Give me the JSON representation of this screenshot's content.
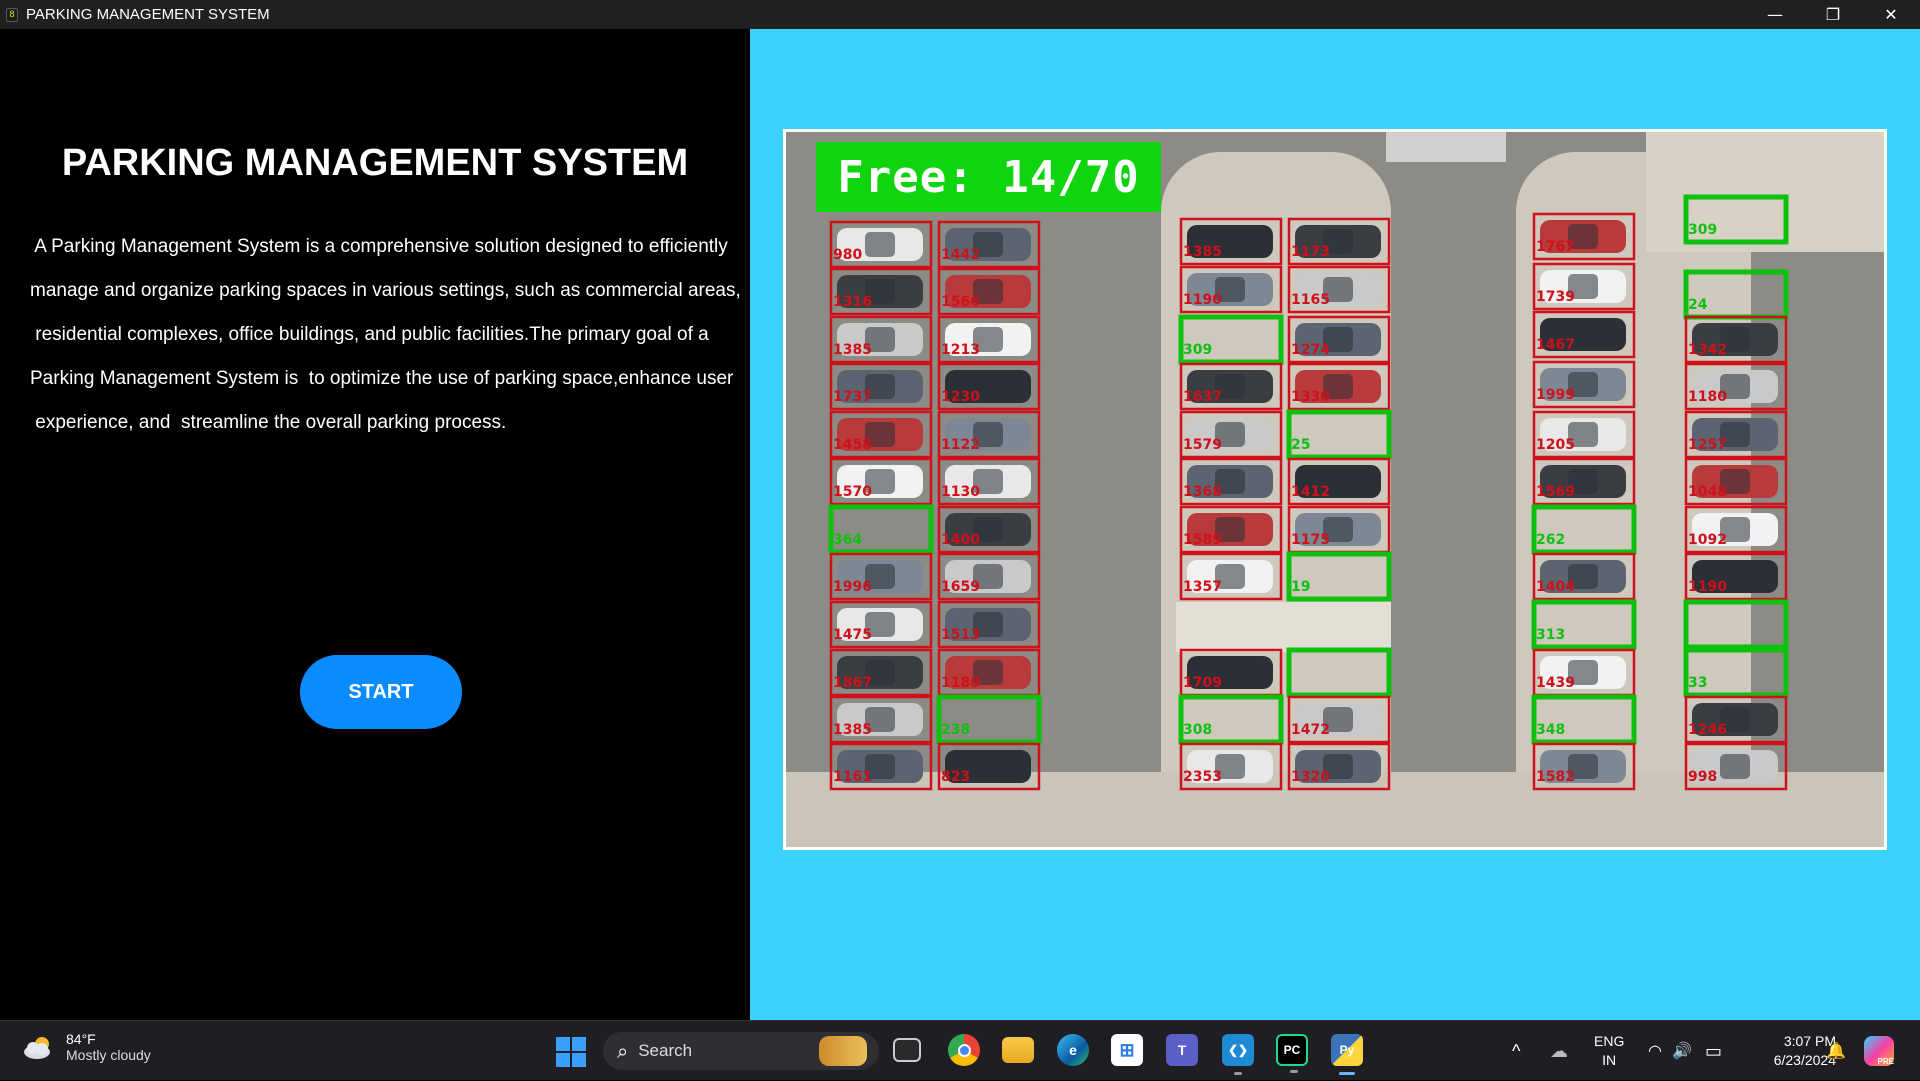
{
  "window": {
    "title": "PARKING MANAGEMENT SYSTEM",
    "app_icon_glyph": "8",
    "minimize_glyph": "—",
    "restore_glyph": "❐",
    "close_glyph": "✕"
  },
  "left_panel": {
    "heading": "PARKING MANAGEMENT SYSTEM",
    "description_lines": [
      " A Parking Management System is a comprehensive solution designed to efficiently",
      "manage and organize parking spaces in various settings, such as commercial areas,",
      " residential complexes, office buildings, and public facilities.The primary goal of a",
      "Parking Management System is  to optimize the use of parking space,enhance user",
      " experience, and  streamline the overall parking process."
    ],
    "start_button": "START"
  },
  "video": {
    "free_label": "Free: 14/70",
    "free_count": 14,
    "total_count": 70,
    "colors": {
      "free": "#10c010",
      "occupied": "#d0101a",
      "label_bg": "#0fd40f"
    },
    "columns": [
      [
        {
          "id": "980",
          "status": "occupied"
        },
        {
          "id": "1316",
          "status": "occupied"
        },
        {
          "id": "1385",
          "status": "occupied"
        },
        {
          "id": "1737",
          "status": "occupied"
        },
        {
          "id": "1458",
          "status": "occupied"
        },
        {
          "id": "1570",
          "status": "occupied"
        },
        {
          "id": "364",
          "status": "free"
        },
        {
          "id": "1996",
          "status": "occupied"
        },
        {
          "id": "1475",
          "status": "occupied"
        },
        {
          "id": "1867",
          "status": "occupied"
        },
        {
          "id": "1385",
          "status": "occupied"
        },
        {
          "id": "1161",
          "status": "occupied"
        }
      ],
      [
        {
          "id": "1442",
          "status": "occupied"
        },
        {
          "id": "1566",
          "status": "occupied"
        },
        {
          "id": "1213",
          "status": "occupied"
        },
        {
          "id": "1230",
          "status": "occupied"
        },
        {
          "id": "1122",
          "status": "occupied"
        },
        {
          "id": "1130",
          "status": "occupied"
        },
        {
          "id": "1400",
          "status": "occupied"
        },
        {
          "id": "1659",
          "status": "occupied"
        },
        {
          "id": "1513",
          "status": "occupied"
        },
        {
          "id": "1180",
          "status": "occupied"
        },
        {
          "id": "238",
          "status": "free"
        },
        {
          "id": "823",
          "status": "occupied"
        }
      ],
      [
        {
          "id": "1385",
          "status": "occupied"
        },
        {
          "id": "1190",
          "status": "occupied"
        },
        {
          "id": "309",
          "status": "free"
        },
        {
          "id": "1637",
          "status": "occupied"
        },
        {
          "id": "1579",
          "status": "occupied"
        },
        {
          "id": "1368",
          "status": "occupied"
        },
        {
          "id": "1589",
          "status": "occupied"
        },
        {
          "id": "1357",
          "status": "occupied"
        },
        {
          "id": "1709",
          "status": "occupied"
        },
        {
          "id": "308",
          "status": "free"
        },
        {
          "id": "2353",
          "status": "occupied"
        }
      ],
      [
        {
          "id": "1173",
          "status": "occupied"
        },
        {
          "id": "1165",
          "status": "occupied"
        },
        {
          "id": "1274",
          "status": "occupied"
        },
        {
          "id": "1330",
          "status": "occupied"
        },
        {
          "id": "25",
          "status": "free"
        },
        {
          "id": "1412",
          "status": "occupied"
        },
        {
          "id": "1175",
          "status": "occupied"
        },
        {
          "id": "19",
          "status": "free"
        },
        {
          "id": "",
          "status": "free"
        },
        {
          "id": "1472",
          "status": "occupied"
        },
        {
          "id": "1320",
          "status": "occupied"
        }
      ],
      [
        {
          "id": "1767",
          "status": "occupied"
        },
        {
          "id": "1739",
          "status": "occupied"
        },
        {
          "id": "1467",
          "status": "occupied"
        },
        {
          "id": "1999",
          "status": "occupied"
        },
        {
          "id": "1205",
          "status": "occupied"
        },
        {
          "id": "1569",
          "status": "occupied"
        },
        {
          "id": "262",
          "status": "free"
        },
        {
          "id": "1404",
          "status": "occupied"
        },
        {
          "id": "313",
          "status": "free"
        },
        {
          "id": "1439",
          "status": "occupied"
        },
        {
          "id": "348",
          "status": "free"
        },
        {
          "id": "1582",
          "status": "occupied"
        }
      ],
      [
        {
          "id": "309",
          "status": "free"
        },
        {
          "id": "24",
          "status": "free"
        },
        {
          "id": "1342",
          "status": "occupied"
        },
        {
          "id": "1180",
          "status": "occupied"
        },
        {
          "id": "1257",
          "status": "occupied"
        },
        {
          "id": "1048",
          "status": "occupied"
        },
        {
          "id": "1092",
          "status": "occupied"
        },
        {
          "id": "1190",
          "status": "occupied"
        },
        {
          "id": "",
          "status": "free"
        },
        {
          "id": "33",
          "status": "free"
        },
        {
          "id": "1246",
          "status": "occupied"
        },
        {
          "id": "998",
          "status": "occupied"
        }
      ]
    ]
  },
  "taskbar": {
    "weather_temp": "84°F",
    "weather_condition": "Mostly cloudy",
    "weather_icon": "partly-cloudy-icon",
    "search_icon_glyph": "⌕",
    "search_placeholder": "Search",
    "apps": [
      {
        "name": "task-view-icon",
        "glyph": "▭"
      },
      {
        "name": "chrome-icon",
        "glyph": ""
      },
      {
        "name": "file-explorer-icon",
        "glyph": ""
      },
      {
        "name": "edge-icon",
        "glyph": "e"
      },
      {
        "name": "microsoft-store-icon",
        "glyph": "⊞"
      },
      {
        "name": "teams-icon",
        "glyph": "T"
      },
      {
        "name": "vscode-icon",
        "glyph": "❮❯"
      },
      {
        "name": "pycharm-icon",
        "glyph": "PC"
      },
      {
        "name": "python-icon",
        "glyph": "Py"
      }
    ],
    "language_top": "ENG",
    "language_bottom": "IN",
    "time": "3:07 PM",
    "date": "6/23/2024",
    "tray_chevron_glyph": "^",
    "cloud_off_glyph": "☁",
    "wifi_glyph": "◠",
    "volume_glyph": "🔊",
    "battery_glyph": "▭",
    "bell_glyph": "🔔",
    "copilot_badge": "PRE"
  }
}
